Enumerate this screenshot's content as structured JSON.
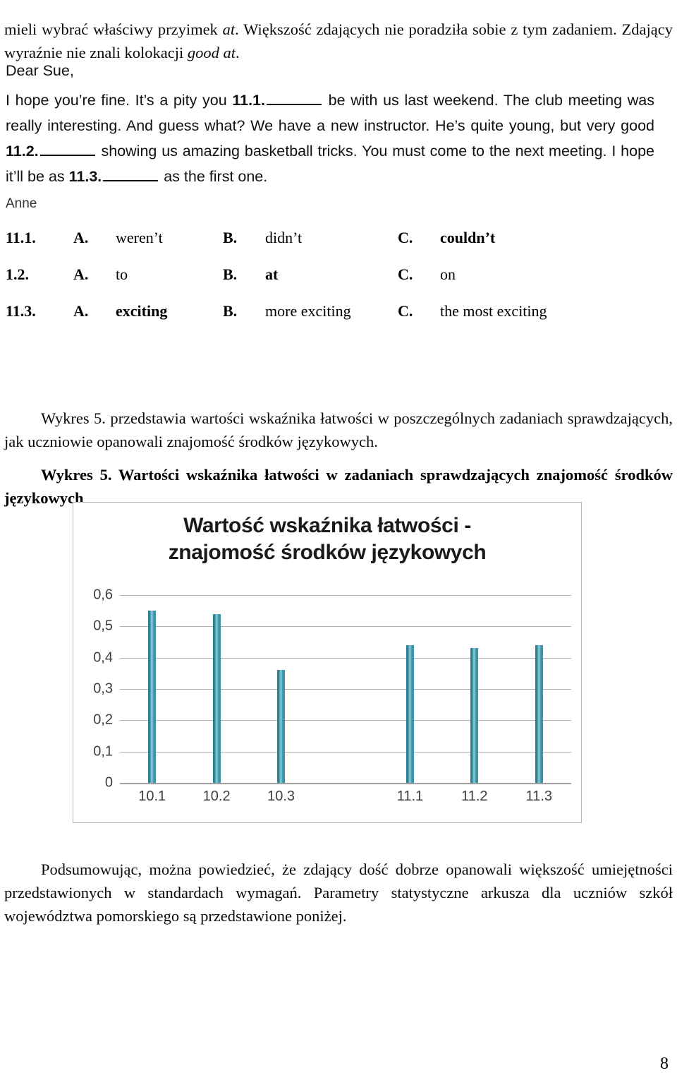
{
  "page": {
    "number": "8"
  },
  "intro": {
    "text_before_italic1": "mieli wybrać właściwy przyimek ",
    "italic1": "at",
    "text_middle": ". Większość zdających nie poradziła sobie z tym zadaniem. Zdający wyraźnie nie znali kolokacji ",
    "italic2": "good at",
    "text_after": "."
  },
  "letter": {
    "salutation": "Dear Sue,",
    "seg1": "I hope you’re fine. It’s a pity you ",
    "gap1": "11.1.",
    "seg2": " be with us last weekend. The club meeting was really interesting. And guess what? We have a new instructor. He’s quite young, but very good ",
    "gap2": "11.2.",
    "seg3": " showing us amazing basketball tricks. You must come to the next meeting. I hope it’ll be as ",
    "gap3": "11.3.",
    "seg4": " as the first one.",
    "signoff": "Anne"
  },
  "answers": {
    "rows": [
      {
        "question": "11.1.",
        "options": [
          {
            "letter": "A.",
            "text": "weren’t",
            "correct": false
          },
          {
            "letter": "B.",
            "text": "didn’t",
            "correct": false
          },
          {
            "letter": "C.",
            "text": "couldn’t",
            "correct": true
          }
        ]
      },
      {
        "question": "1.2.",
        "options": [
          {
            "letter": "A.",
            "text": "to",
            "correct": false
          },
          {
            "letter": "B.",
            "text": "at",
            "correct": true
          },
          {
            "letter": "C.",
            "text": "on",
            "correct": false
          }
        ]
      },
      {
        "question": "11.3.",
        "options": [
          {
            "letter": "A.",
            "text": "exciting",
            "correct": true
          },
          {
            "letter": "B.",
            "text": "more exciting",
            "correct": false
          },
          {
            "letter": "C.",
            "text": "the most exciting",
            "correct": false
          }
        ]
      }
    ]
  },
  "wykres_intro": {
    "text": "Wykres 5. przedstawia wartości wskaźnika łatwości w poszczególnych zadaniach sprawdzających, jak uczniowie opanowali znajomość środków językowych."
  },
  "wykres_caption": {
    "text": "Wykres 5. Wartości wskaźnika łatwości w zadaniach sprawdzających znajomość środków językowych"
  },
  "closing": {
    "text": "Podsumowując, można powiedzieć, że zdający dość dobrze opanowali większość umiejętności przedstawionych w standardach wymagań. Parametry statystyczne arkusza dla uczniów szkół województwa pomorskiego są przedstawione poniżej."
  },
  "chart_data": {
    "type": "bar",
    "title": "Wartość wskaźnika łatwości - znajomość środków językowych",
    "title_line1": "Wartość wskaźnika łatwości -",
    "title_line2": "znajomość środków językowych",
    "xlabel": "",
    "ylabel": "",
    "categories": [
      "10.1",
      "10.2",
      "10.3",
      "",
      "11.1",
      "11.2",
      "11.3"
    ],
    "values": [
      0.55,
      0.54,
      0.36,
      null,
      0.44,
      0.43,
      0.44
    ],
    "ylim": [
      0,
      0.6
    ],
    "ytick_labels": [
      "0,6",
      "0,5",
      "0,4",
      "0,3",
      "0,2",
      "0,1",
      "0"
    ],
    "ytick_values": [
      0.6,
      0.5,
      0.4,
      0.3,
      0.2,
      0.1,
      0
    ],
    "grid": true,
    "legend": false,
    "bar_color": "#3d93a8",
    "gridline_color": "#b0b0b0",
    "frame_color": "#b6b6b6"
  }
}
